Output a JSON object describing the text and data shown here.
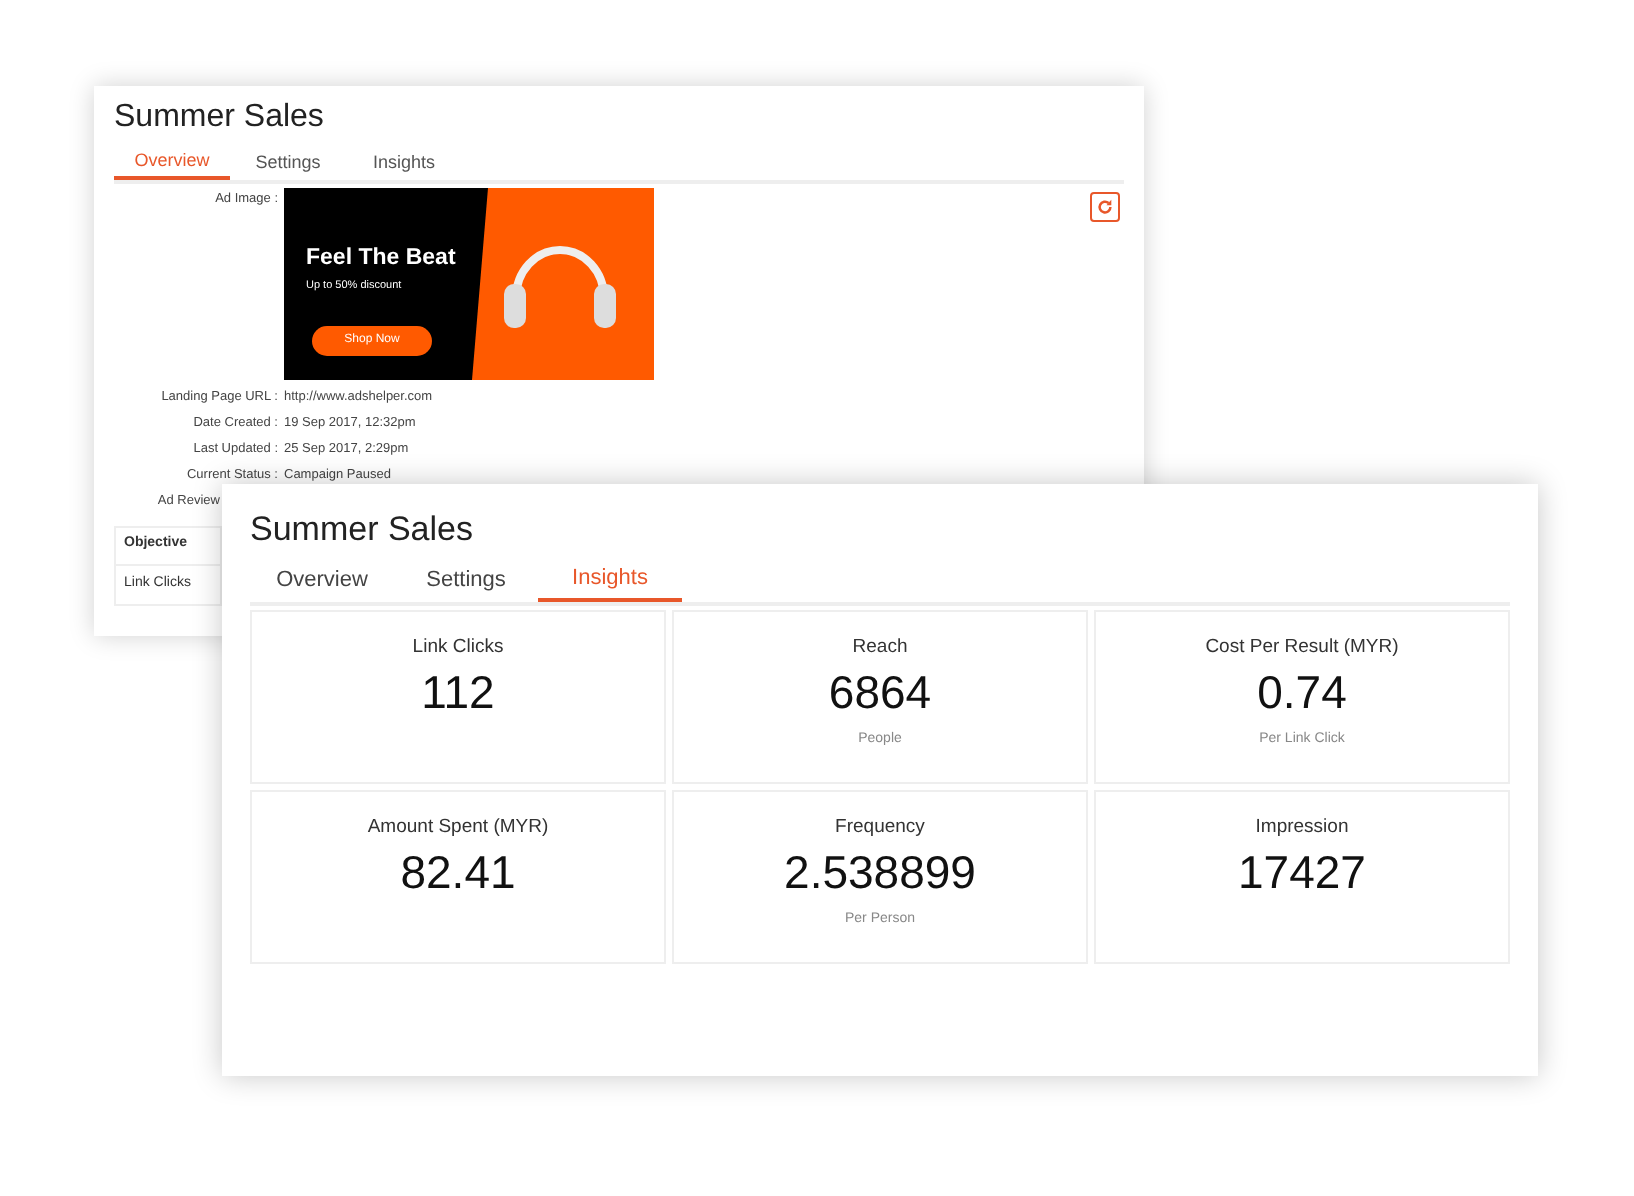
{
  "back_window": {
    "title": "Summer Sales",
    "tabs": [
      {
        "label": "Overview",
        "selected": true
      },
      {
        "label": "Settings",
        "selected": false
      },
      {
        "label": "Insights",
        "selected": false
      }
    ],
    "ad_image": {
      "label": "Ad Image :",
      "headline": "Feel The Beat",
      "subline": "Up to 50% discount",
      "button": "Shop Now"
    },
    "details": [
      {
        "label": "Landing Page URL :",
        "value": "http://www.adshelper.com"
      },
      {
        "label": "Date Created :",
        "value": "19 Sep 2017, 12:32pm"
      },
      {
        "label": "Last Updated :",
        "value": "25 Sep 2017, 2:29pm"
      },
      {
        "label": "Current Status :",
        "value": "Campaign Paused"
      },
      {
        "label": "Ad Review"
      }
    ],
    "table": {
      "header": "Objective",
      "rows": [
        "Link Clicks"
      ]
    }
  },
  "front_window": {
    "title": "Summer Sales",
    "tabs": [
      {
        "label": "Overview",
        "selected": false
      },
      {
        "label": "Settings",
        "selected": false
      },
      {
        "label": "Insights",
        "selected": true
      }
    ],
    "metrics": [
      {
        "label": "Link Clicks",
        "value": "112"
      },
      {
        "label": "Reach",
        "value": "6864",
        "note": "People"
      },
      {
        "label": "Cost Per Result (MYR)",
        "value": "0.74",
        "note": "Per Link Click"
      },
      {
        "label": "Amount Spent (MYR)",
        "value": "82.41"
      },
      {
        "label": "Frequency",
        "value": "2.538899",
        "note": "Per Person"
      },
      {
        "label": "Impression",
        "value": "17427"
      }
    ]
  }
}
